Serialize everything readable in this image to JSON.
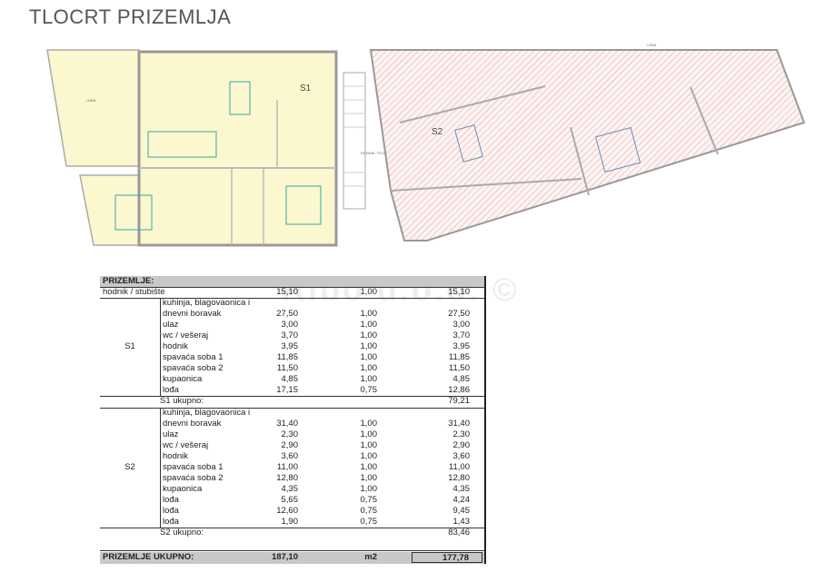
{
  "title": "TLOCRT PRIZEMLJA",
  "watermark": "Ribo d.o.o. ©",
  "plan": {
    "s1_label": "S1",
    "s2_label": "S2",
    "stair_label": "HODNIK / STUBIŠTE",
    "loggia_label": "LOĐA",
    "colors": {
      "s1_fill": "#fbf8cf",
      "s2_hatch": "#d98a8a",
      "wall": "#999999",
      "furniture": "#3aa3a3"
    }
  },
  "table": {
    "header": "PRIZEMLJE:",
    "common": {
      "name": "hodnik / stubište",
      "area": "15,10",
      "coef": "1,00",
      "total": "15,10"
    },
    "units": [
      {
        "label": "S1",
        "rows": [
          {
            "name": "kuhinja, blagovaonica i",
            "area": "",
            "coef": "",
            "total": ""
          },
          {
            "name": "dnevni boravak",
            "area": "27,50",
            "coef": "1,00",
            "total": "27,50"
          },
          {
            "name": "ulaz",
            "area": "3,00",
            "coef": "1,00",
            "total": "3,00"
          },
          {
            "name": "wc / vešeraj",
            "area": "3,70",
            "coef": "1,00",
            "total": "3,70"
          },
          {
            "name": "hodnik",
            "area": "3,95",
            "coef": "1,00",
            "total": "3,95"
          },
          {
            "name": "spavaća soba 1",
            "area": "11,85",
            "coef": "1,00",
            "total": "11,85"
          },
          {
            "name": "spavaća soba 2",
            "area": "11,50",
            "coef": "1,00",
            "total": "11,50"
          },
          {
            "name": "kupaonica",
            "area": "4,85",
            "coef": "1,00",
            "total": "4,85"
          },
          {
            "name": "lođa",
            "area": "17,15",
            "coef": "0,75",
            "total": "12,86"
          }
        ],
        "subtotal_label": "S1 ukupno:",
        "subtotal": "79,21"
      },
      {
        "label": "S2",
        "rows": [
          {
            "name": "kuhinja, blagovaonica i",
            "area": "",
            "coef": "",
            "total": ""
          },
          {
            "name": "dnevni boravak",
            "area": "31,40",
            "coef": "1,00",
            "total": "31,40"
          },
          {
            "name": "ulaz",
            "area": "2,30",
            "coef": "1,00",
            "total": "2,30"
          },
          {
            "name": "wc / vešeraj",
            "area": "2,90",
            "coef": "1,00",
            "total": "2,90"
          },
          {
            "name": "hodnik",
            "area": "3,60",
            "coef": "1,00",
            "total": "3,60"
          },
          {
            "name": "spavaća soba 1",
            "area": "11,00",
            "coef": "1,00",
            "total": "11,00"
          },
          {
            "name": "spavaća soba 2",
            "area": "12,80",
            "coef": "1,00",
            "total": "12,80"
          },
          {
            "name": "kupaonica",
            "area": "4,35",
            "coef": "1,00",
            "total": "4,35"
          },
          {
            "name": "lođa",
            "area": "5,65",
            "coef": "0,75",
            "total": "4,24"
          },
          {
            "name": "lođa",
            "area": "12,60",
            "coef": "0,75",
            "total": "9,45"
          },
          {
            "name": "lođa",
            "area": "1,90",
            "coef": "0,75",
            "total": "1,43"
          }
        ],
        "subtotal_label": "S2 ukupno:",
        "subtotal": "83,46"
      }
    ],
    "grand_total": {
      "label": "PRIZEMLJE UKUPNO:",
      "area": "187,10",
      "unit": "m2",
      "total": "177,78"
    }
  }
}
